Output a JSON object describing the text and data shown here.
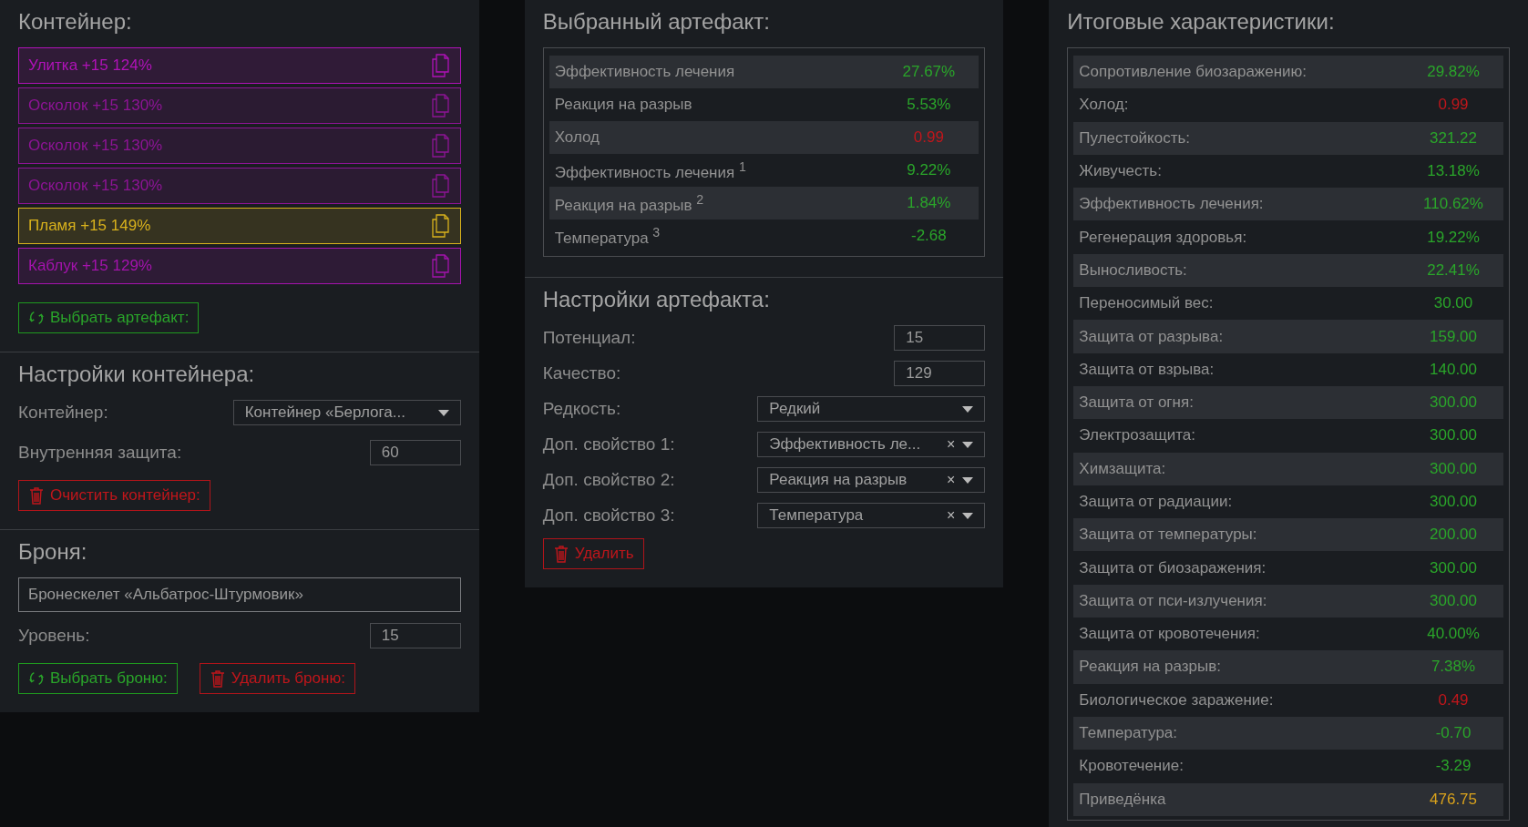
{
  "container": {
    "title": "Контейнер:",
    "items": [
      {
        "label": "Улитка +15 124%",
        "color": "#b012b8"
      },
      {
        "label": "Осколок +15 130%",
        "color": "#8e1496"
      },
      {
        "label": "Осколок +15 130%",
        "color": "#8e1496"
      },
      {
        "label": "Осколок +15 130%",
        "color": "#8e1496"
      },
      {
        "label": "Пламя +15 149%",
        "color": "#d9b21c"
      },
      {
        "label": "Каблук +15 129%",
        "color": "#a413ad"
      }
    ],
    "choose_button": "Выбрать артефакт:"
  },
  "container_settings": {
    "title": "Настройки контейнера:",
    "fields": [
      {
        "kind": "select",
        "label": "Контейнер:",
        "value": "Контейнер «Берлога..."
      },
      {
        "kind": "number",
        "label": "Внутренняя защита:",
        "value": "60"
      }
    ],
    "clear_button": "Очистить контейнер:"
  },
  "armor": {
    "title": "Броня:",
    "name": "Бронескелет «Альбатрос-Штурмовик»",
    "level_label": "Уровень:",
    "level_value": "15",
    "choose_button": "Выбрать броню:",
    "delete_button": "Удалить броню:"
  },
  "selected_artifact": {
    "title": "Выбранный артефакт:",
    "rows": [
      {
        "name": "Эффективность лечения",
        "value": "27.67%",
        "color": "#2aa52a"
      },
      {
        "name": "Реакция на разрыв",
        "value": "5.53%",
        "color": "#2aa52a"
      },
      {
        "name": "Холод",
        "value": "0.99",
        "color": "#c0161b"
      },
      {
        "name": "Эффективность лечения $^{1}$",
        "value": "9.22%",
        "color": "#2aa52a"
      },
      {
        "name": "Реакция на разрыв $^{2}$",
        "value": "1.84%",
        "color": "#2aa52a"
      },
      {
        "name": "Температура $^{3}$",
        "value": "-2.68",
        "color": "#2aa52a"
      }
    ]
  },
  "artifact_settings": {
    "title": "Настройки артефакта:",
    "fields": [
      {
        "kind": "number",
        "label": "Потенциал:",
        "value": "15"
      },
      {
        "kind": "number",
        "label": "Качество:",
        "value": "129"
      },
      {
        "kind": "select",
        "label": "Редкость:",
        "value": "Редкий"
      },
      {
        "kind": "select",
        "label": "Доп. свойство 1:",
        "value": "Эффективность ле...",
        "clear": "×"
      },
      {
        "kind": "select",
        "label": "Доп. свойство 2:",
        "value": "Реакция на разрыв",
        "clear": "×"
      },
      {
        "kind": "select",
        "label": "Доп. свойство 3:",
        "value": "Температура",
        "clear": "×"
      }
    ],
    "delete_button": "Удалить"
  },
  "totals": {
    "title": "Итоговые характеристики:",
    "rows": [
      {
        "name": "Сопротивление биозаражению:",
        "value": "29.82%",
        "color": "#2aa52a"
      },
      {
        "name": "Холод:",
        "value": "0.99",
        "color": "#c0161b"
      },
      {
        "name": "Пулестойкость:",
        "value": "321.22",
        "color": "#2aa52a"
      },
      {
        "name": "Живучесть:",
        "value": "13.18%",
        "color": "#2aa52a"
      },
      {
        "name": "Эффективность лечения:",
        "value": "110.62%",
        "color": "#2aa52a"
      },
      {
        "name": "Регенерация здоровья:",
        "value": "19.22%",
        "color": "#2aa52a"
      },
      {
        "name": "Выносливость:",
        "value": "22.41%",
        "color": "#2aa52a"
      },
      {
        "name": "Переносимый вес:",
        "value": "30.00",
        "color": "#2aa52a"
      },
      {
        "name": "Защита от разрыва:",
        "value": "159.00",
        "color": "#2aa52a"
      },
      {
        "name": "Защита от взрыва:",
        "value": "140.00",
        "color": "#2aa52a"
      },
      {
        "name": "Защита от огня:",
        "value": "300.00",
        "color": "#2aa52a"
      },
      {
        "name": "Электрозащита:",
        "value": "300.00",
        "color": "#2aa52a"
      },
      {
        "name": "Химзащита:",
        "value": "300.00",
        "color": "#2aa52a"
      },
      {
        "name": "Защита от радиации:",
        "value": "300.00",
        "color": "#2aa52a"
      },
      {
        "name": "Защита от температуры:",
        "value": "200.00",
        "color": "#2aa52a"
      },
      {
        "name": "Защита от биозаражения:",
        "value": "300.00",
        "color": "#2aa52a"
      },
      {
        "name": "Защита от пси-излучения:",
        "value": "300.00",
        "color": "#2aa52a"
      },
      {
        "name": "Защита от кровотечения:",
        "value": "40.00%",
        "color": "#2aa52a"
      },
      {
        "name": "Реакция на разрыв:",
        "value": "7.38%",
        "color": "#2aa52a"
      },
      {
        "name": "Биологическое заражение:",
        "value": "0.49",
        "color": "#c0161b"
      },
      {
        "name": "Температура:",
        "value": "-0.70",
        "color": "#2aa52a"
      },
      {
        "name": "Кровотечение:",
        "value": "-3.29",
        "color": "#2aa52a"
      },
      {
        "name": "Приведёнка",
        "value": "476.75",
        "color": "#d9a21c"
      }
    ]
  }
}
